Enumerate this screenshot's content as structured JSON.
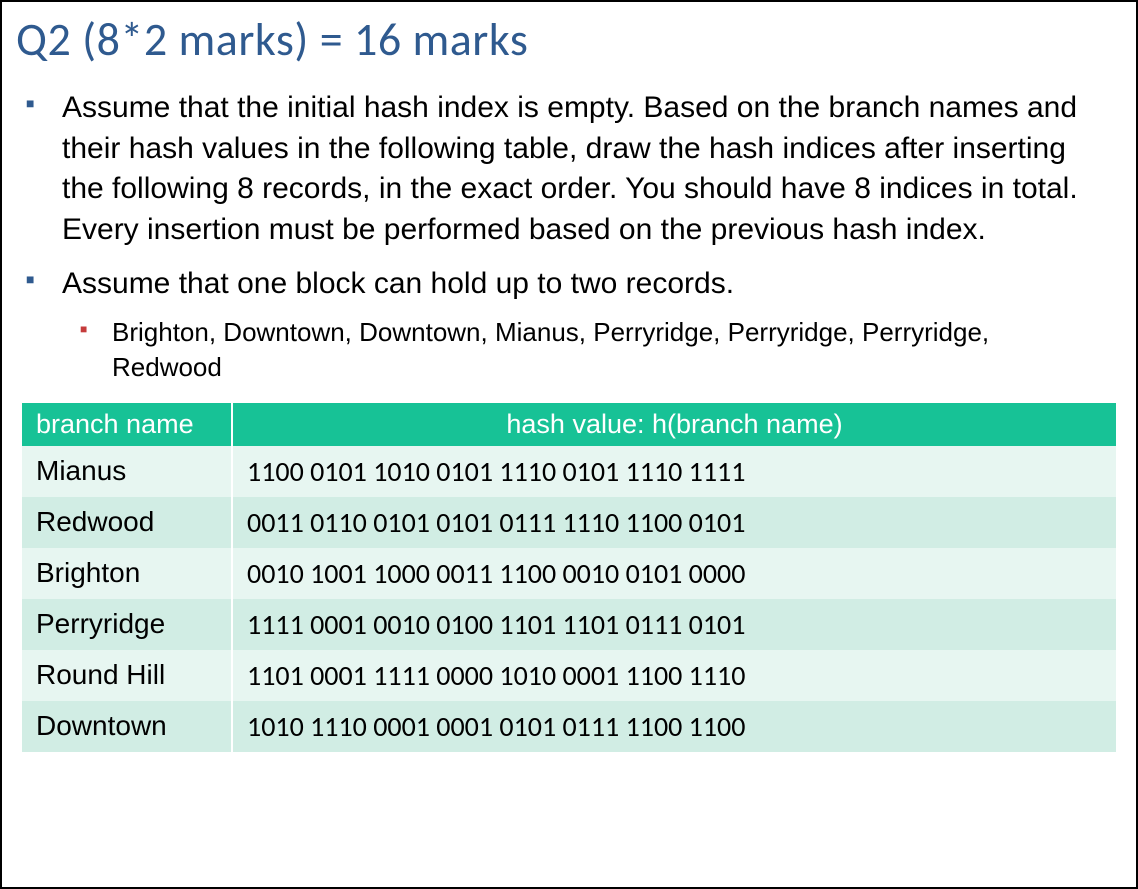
{
  "title": "Q2 (8*2 marks) = 16 marks",
  "bullets": {
    "b1": "Assume that the initial hash index is empty. Based on the branch names and their hash values in the following table, draw the hash indices after inserting the following 8 records, in the exact order. You should have 8 indices in total. Every insertion must be performed based on the previous hash index.",
    "b2": "Assume that one block can hold up to two records.",
    "sub1": "Brighton, Downtown, Downtown, Mianus, Perryridge, Perryridge, Perryridge, Redwood"
  },
  "table": {
    "header": {
      "col1": "branch name",
      "col2": "hash value: h(branch name)"
    },
    "rows": [
      {
        "name": "Mianus",
        "hash": "1100 0101 1010 0101 1110 0101 1110 1111"
      },
      {
        "name": "Redwood",
        "hash": "0011 0110 0101 0101 0111 1110 1100 0101"
      },
      {
        "name": "Brighton",
        "hash": "0010 1001 1000 0011 1100 0010 0101 0000"
      },
      {
        "name": "Perryridge",
        "hash": "1111 0001 0010 0100 1101 1101 0111 0101"
      },
      {
        "name": "Round Hill",
        "hash": "1101 0001 1111 0000 1010 0001 1100 1110"
      },
      {
        "name": "Downtown",
        "hash": "1010 1110 0001 0001 0101 0111 1100 1100"
      }
    ]
  }
}
